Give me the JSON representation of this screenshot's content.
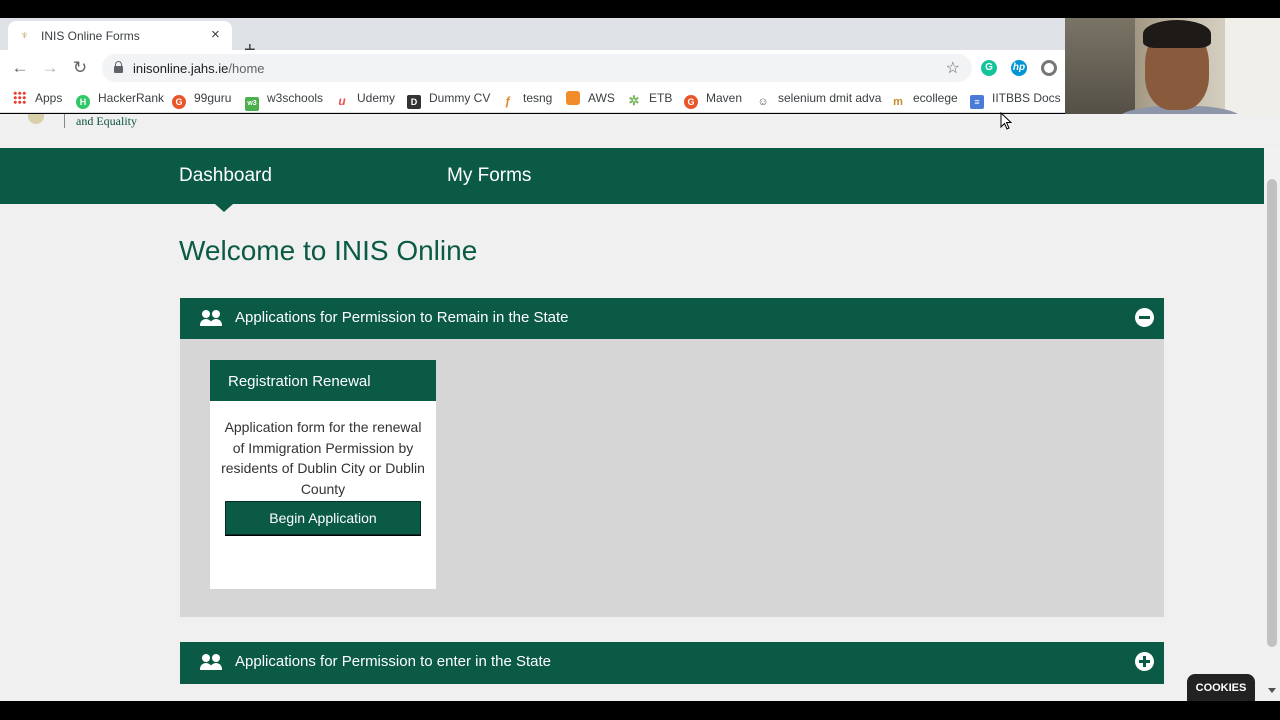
{
  "browser": {
    "tab_title": "INIS Online Forms",
    "tab_close": "×",
    "new_tab": "+",
    "url_host": "inisonline.jahs.ie",
    "url_path": "/home",
    "back": "←",
    "forward": "→",
    "reload": "↻",
    "star": "☆"
  },
  "bookmarks": [
    {
      "label": "Apps",
      "icon": "apps-grid-icon"
    },
    {
      "label": "HackerRank",
      "icon": "hackerrank-icon",
      "color": "#2ec866",
      "glyph": "H"
    },
    {
      "label": "99guru",
      "icon": "guru-icon",
      "color": "#e8552b",
      "glyph": "G"
    },
    {
      "label": "w3schools",
      "icon": "w3schools-icon",
      "color": "#4caf50",
      "glyph": "w3"
    },
    {
      "label": "Udemy",
      "icon": "udemy-icon",
      "color": "#ec5252",
      "glyph": "U"
    },
    {
      "label": "Dummy CV",
      "icon": "dummy-cv-icon",
      "color": "#333333",
      "glyph": "D"
    },
    {
      "label": "tesng",
      "icon": "tesng-icon",
      "color": "#d98c2b",
      "glyph": "t"
    },
    {
      "label": "AWS",
      "icon": "aws-icon",
      "color": "#f28c28",
      "glyph": "A"
    },
    {
      "label": "ETB",
      "icon": "etb-icon",
      "color": "#7bb661",
      "glyph": "E"
    },
    {
      "label": "Maven",
      "icon": "maven-icon",
      "color": "#e8552b",
      "glyph": "G"
    },
    {
      "label": "selenium dmit adva",
      "icon": "selenium-icon",
      "color": "#666666",
      "glyph": "S"
    },
    {
      "label": "ecollege",
      "icon": "ecollege-icon",
      "color": "#c58b2b",
      "glyph": "m"
    },
    {
      "label": "IITBBS Docs",
      "icon": "docs-icon",
      "color": "#4a7bd8",
      "glyph": "≡"
    }
  ],
  "site": {
    "logo_text": "and Equality",
    "nav": {
      "dashboard": "Dashboard",
      "my_forms": "My Forms"
    },
    "welcome": "Welcome to INIS Online",
    "panels": [
      {
        "title": "Applications for Permission to Remain in the State",
        "state": "expanded"
      },
      {
        "title": "Applications for Permission to enter in the State",
        "state": "collapsed"
      }
    ],
    "card": {
      "title": "Registration Renewal",
      "description": "Application form for the renewal of Immigration Permission by residents of Dublin City or Dublin County",
      "button": "Begin Application"
    },
    "cookies": "COOKIES"
  },
  "colors": {
    "brand_green": "#0a5a45",
    "page_bg": "#f0f0f0",
    "panel_bg": "#d6d6d6"
  }
}
